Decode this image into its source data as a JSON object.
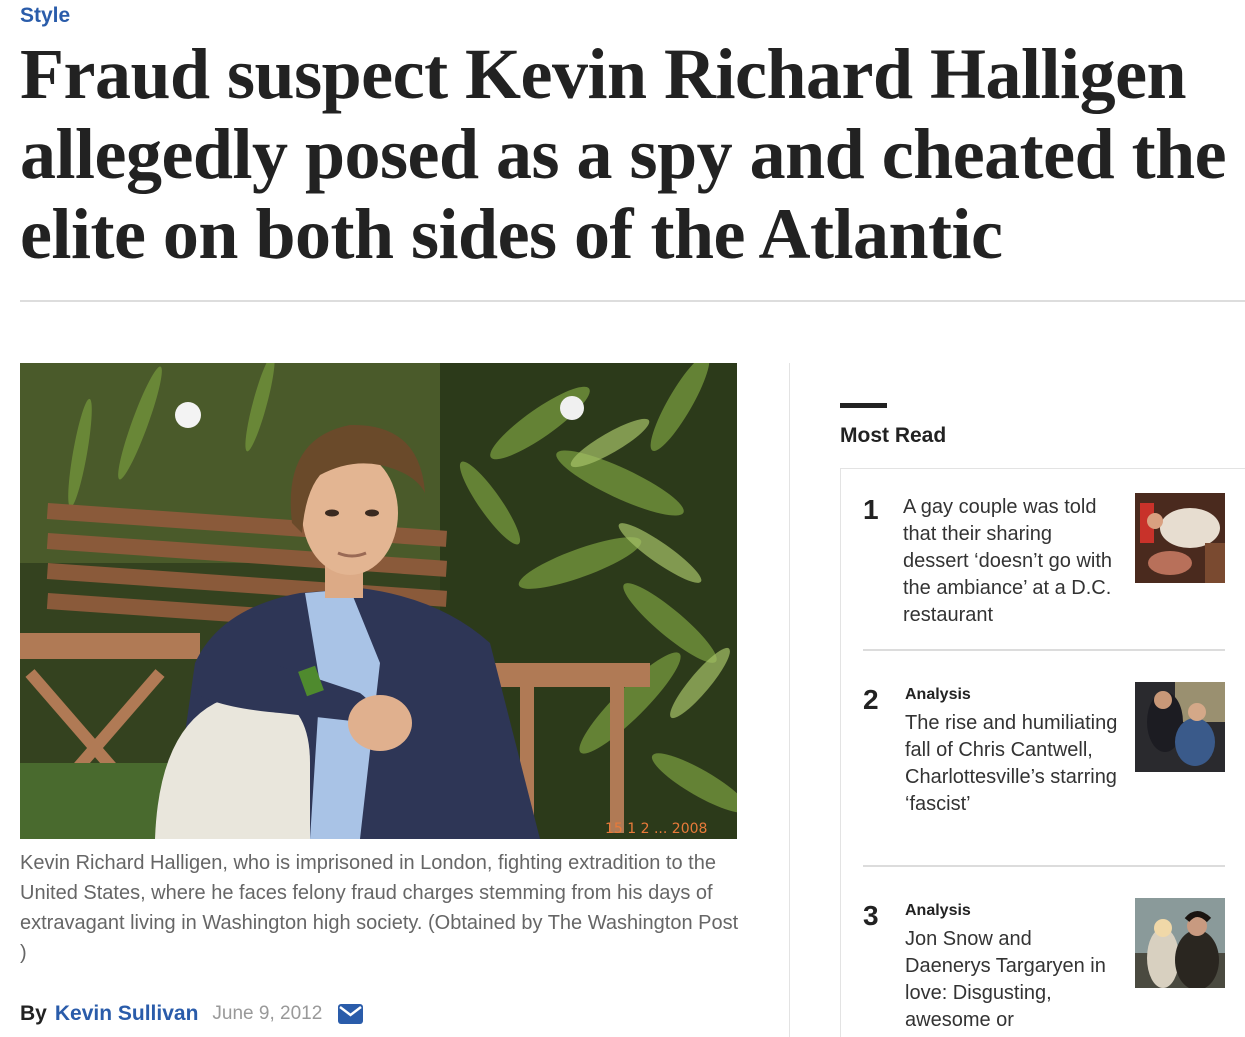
{
  "section": {
    "label": "Style"
  },
  "article": {
    "headline": "Fraud suspect Kevin Richard Halligen allegedly posed as a spy and cheated the elite on both sides of the Atlantic",
    "photo": {
      "subject": "man-on-bench-photo"
    },
    "caption": "Kevin Richard Halligen, who is imprisoned in London, fighting extradition to the United States, where he faces felony fraud charges stemming from his days of extravagant living in Washington high society. (Obtained by The Washington Post )",
    "byline": {
      "by_label": "By",
      "author": "Kevin Sullivan",
      "date": "June 9, 2012",
      "email_icon": "envelope-icon"
    }
  },
  "most_read": {
    "title": "Most Read",
    "items": [
      {
        "rank": "1",
        "label": "",
        "headline": "A gay couple was told that their sharing dessert ‘doesn’t go with the ambiance’ at a D.C. restaurant"
      },
      {
        "rank": "2",
        "label": "Analysis",
        "headline": "The rise and humiliating fall of Chris Cantwell, Charlottesville’s starring ‘fascist’"
      },
      {
        "rank": "3",
        "label": "Analysis",
        "headline": "Jon Snow and Daenerys Targaryen in love: Disgusting, awesome or"
      }
    ]
  },
  "colors": {
    "link_blue": "#2a5caa",
    "text_dark": "#222222",
    "caption_gray": "#666666",
    "date_gray": "#999999",
    "rule_gray": "#dddddd"
  }
}
